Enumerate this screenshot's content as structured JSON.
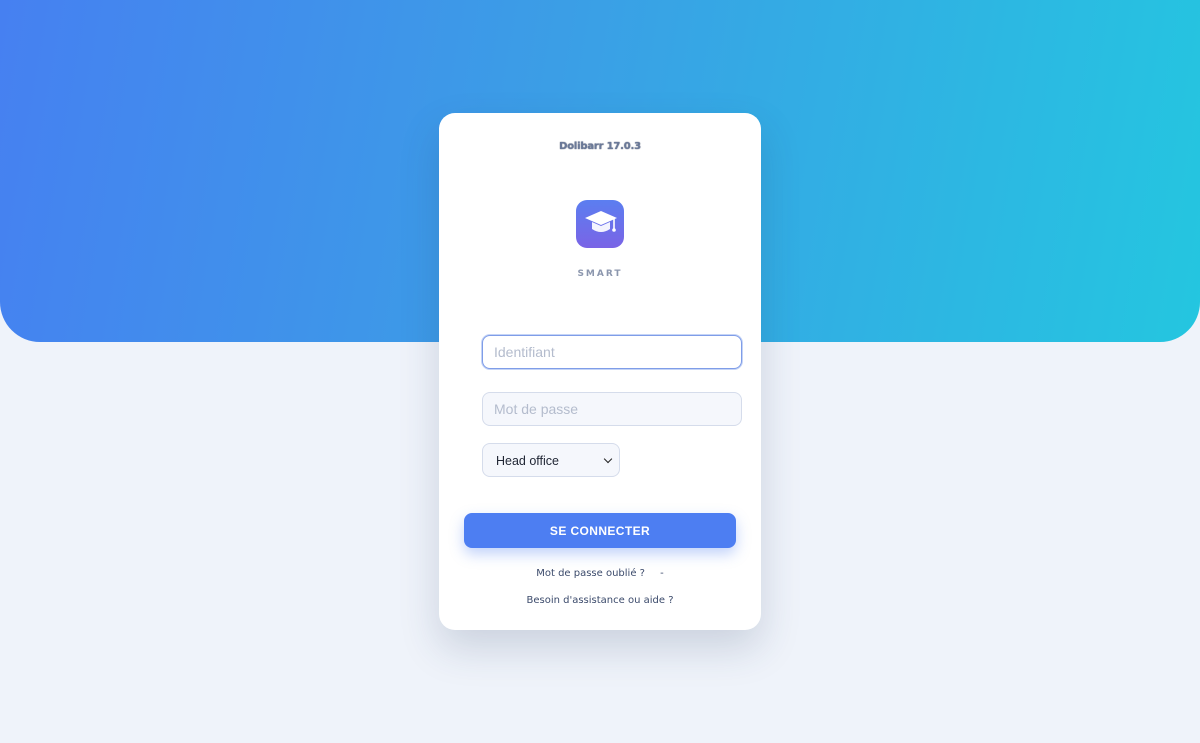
{
  "app": {
    "version_label": "Dolibarr 17.0.3",
    "brand_name": "SMART",
    "logo_icon": "graduation-cap-icon",
    "accent_color": "#4d7ef2"
  },
  "login_form": {
    "username_placeholder": "Identifiant",
    "username_value": "",
    "password_placeholder": "Mot de passe",
    "password_value": "",
    "entity_selected": "Head office",
    "submit_label": "SE CONNECTER"
  },
  "links": {
    "forgot_password": "Mot de passe oublié ?",
    "separator": "-",
    "help": "Besoin d'assistance ou aide ?"
  }
}
